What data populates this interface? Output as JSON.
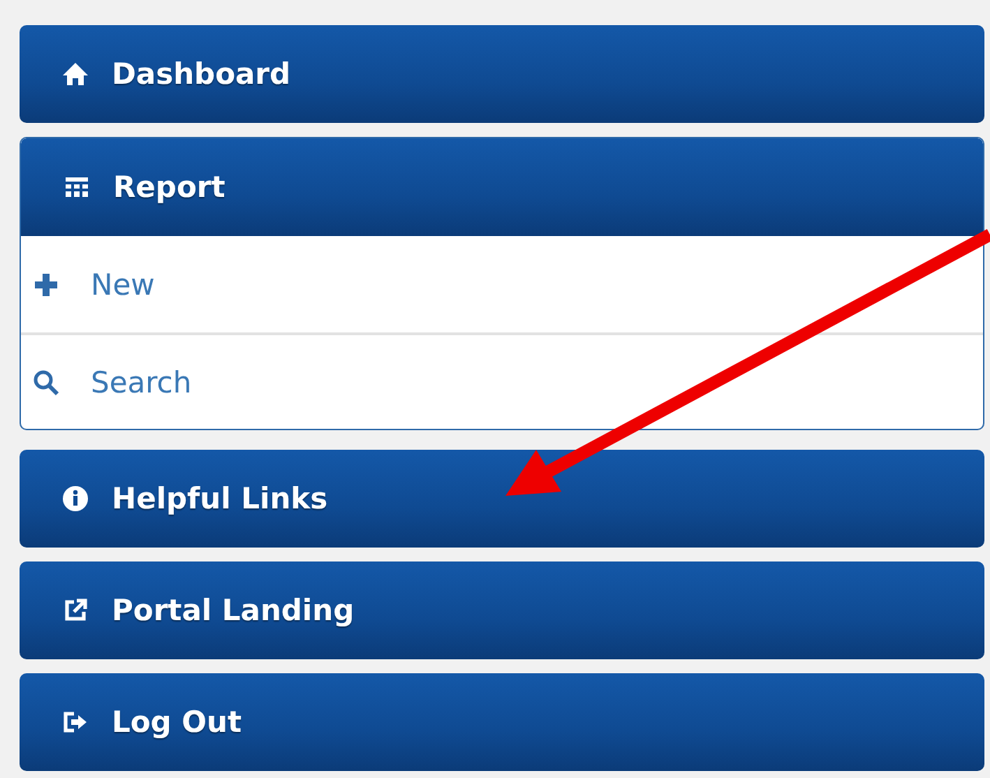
{
  "menu": [
    {
      "kind": "link",
      "label": "Dashboard"
    },
    {
      "kind": "group",
      "label": "Report",
      "expanded": true,
      "children": [
        {
          "label": "New"
        },
        {
          "label": "Search"
        }
      ]
    },
    {
      "kind": "link",
      "label": "Helpful Links"
    },
    {
      "kind": "link",
      "label": "Portal Landing"
    },
    {
      "kind": "link",
      "label": "Log Out"
    }
  ]
}
